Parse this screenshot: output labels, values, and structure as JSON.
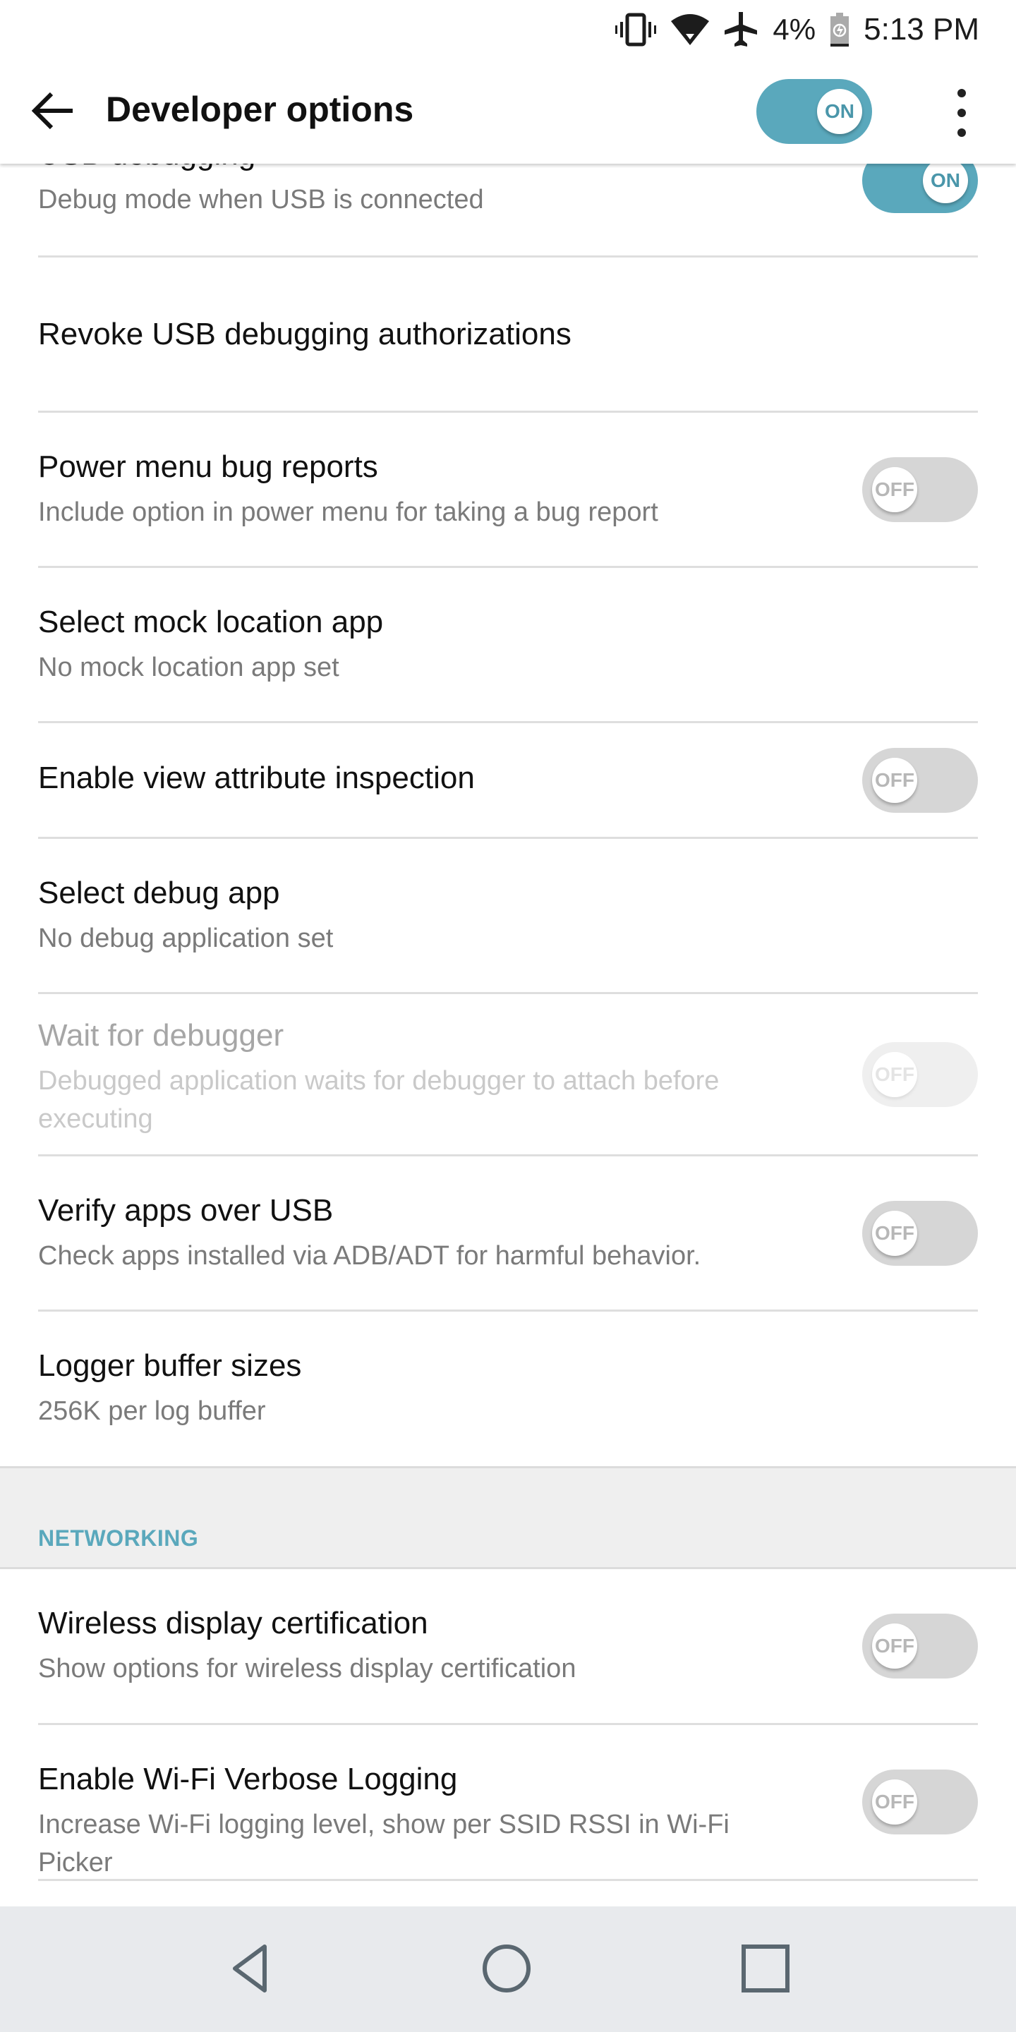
{
  "status_bar": {
    "icons": [
      "vibrate-icon",
      "wifi-icon",
      "airplane-mode-icon",
      "battery-charging-icon"
    ],
    "battery_percent": "4%",
    "time": "5:13 PM"
  },
  "app_bar": {
    "title": "Developer options",
    "master_toggle": {
      "state": "on",
      "label": "ON"
    },
    "back_icon": "arrow-back-icon",
    "more_icon": "more-vert-icon"
  },
  "settings": [
    {
      "title": "USB debugging",
      "summary": "Debug mode when USB is connected",
      "toggle": "on",
      "toggle_label": "ON",
      "enabled": true
    },
    {
      "title": "Revoke USB debugging authorizations",
      "summary": null,
      "toggle": null,
      "enabled": true
    },
    {
      "title": "Power menu bug reports",
      "summary": "Include option in power menu for taking a bug report",
      "toggle": "off",
      "toggle_label": "OFF",
      "enabled": true
    },
    {
      "title": "Select mock location app",
      "summary": "No mock location app set",
      "toggle": null,
      "enabled": true
    },
    {
      "title": "Enable view attribute inspection",
      "summary": null,
      "toggle": "off",
      "toggle_label": "OFF",
      "enabled": true
    },
    {
      "title": "Select debug app",
      "summary": "No debug application set",
      "toggle": null,
      "enabled": true
    },
    {
      "title": "Wait for debugger",
      "summary": "Debugged application waits for debugger to attach before executing",
      "toggle": "off",
      "toggle_label": "OFF",
      "enabled": false
    },
    {
      "title": "Verify apps over USB",
      "summary": "Check apps installed via ADB/ADT for harmful behavior.",
      "toggle": "off",
      "toggle_label": "OFF",
      "enabled": true
    },
    {
      "title": "Logger buffer sizes",
      "summary": "256K per log buffer",
      "toggle": null,
      "enabled": true
    }
  ],
  "section": {
    "label": "NETWORKING"
  },
  "networking_settings": [
    {
      "title": "Wireless display certification",
      "summary": "Show options for wireless display certification",
      "toggle": "off",
      "toggle_label": "OFF",
      "enabled": true
    },
    {
      "title": "Enable Wi-Fi Verbose Logging",
      "summary": "Increase Wi-Fi logging level, show per SSID RSSI in Wi-Fi Picker",
      "toggle": "off",
      "toggle_label": "OFF",
      "enabled": true
    }
  ],
  "nav_bar": {
    "buttons": [
      "back-triangle-icon",
      "home-circle-icon",
      "recents-square-icon"
    ]
  },
  "colors": {
    "accent": "#5aa8bc",
    "toggle_off": "#d6d6d6",
    "section_bg": "#efefef",
    "nav_bg": "#e8eaed"
  }
}
